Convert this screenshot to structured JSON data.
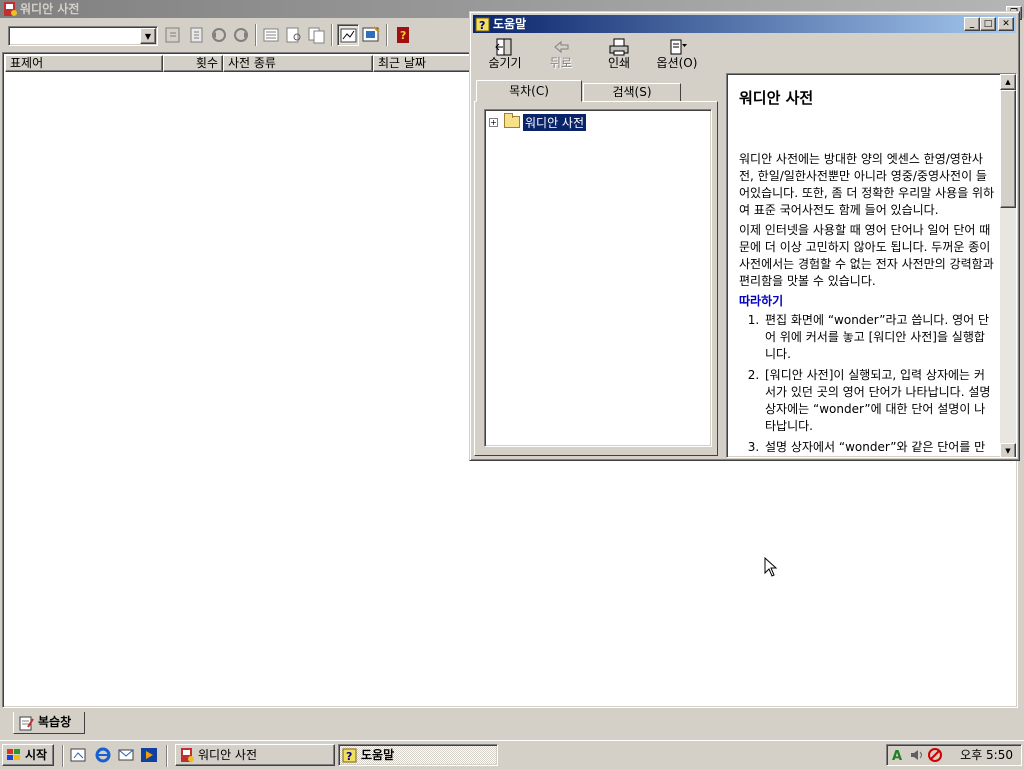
{
  "main": {
    "title": "워디안 사전",
    "search": {
      "value": "",
      "placeholder": ""
    },
    "columns": [
      "표제어",
      "횟수",
      "사전 종류",
      "최근 날짜"
    ],
    "bottom_tab": "복습창"
  },
  "help": {
    "title": "도움말",
    "toolbar": {
      "hide": "숨기기",
      "back": "뒤로",
      "print": "인쇄",
      "options": "옵션(O)"
    },
    "tabs": {
      "contents": "목차(C)",
      "search": "검색(S)"
    },
    "tree": {
      "root": "워디안 사전"
    },
    "topic": {
      "heading": "워디안 사전",
      "para1": "워디안 사전에는 방대한 양의 엣센스 한영/영한사전, 한일/일한사전뿐만 아니라 영중/중영사전이 들어있습니다. 또한, 좀 더 정확한 우리말 사용을 위하여 표준 국어사전도 함께 들어 있습니다.",
      "para2": "이제 인터넷을 사용할 때 영어 단어나 일어 단어 때문에 더 이상 고민하지 않아도 됩니다. 두꺼운 종이 사전에서는 경험할 수 없는 전자 사전만의 강력함과 편리함을 맛볼 수 있습니다.",
      "section": "따라하기",
      "steps": [
        "편집 화면에 “wonder”라고 씁니다. 영어 단어 위에 커서를 놓고 [워디안 사전]을 실행합니다.",
        "[워디안 사전]이 실행되고, 입력 상자에는 커서가 있던 곳의 영어 단어가 나타납니다. 설명 상자에는 “wonder”에 대한 단어 설명이 나타납니다.",
        "설명 상자에서 “wonder”와 같은 단어를 만"
      ]
    }
  },
  "taskbar": {
    "start": "시작",
    "tasks": [
      "워디안 사전",
      "도움말"
    ],
    "clock": "오후 5:50"
  },
  "colors": {
    "active_title": "#0a246a",
    "inactive_title": "#808080",
    "face": "#d4d0c8",
    "link_heading": "#0000c0"
  }
}
